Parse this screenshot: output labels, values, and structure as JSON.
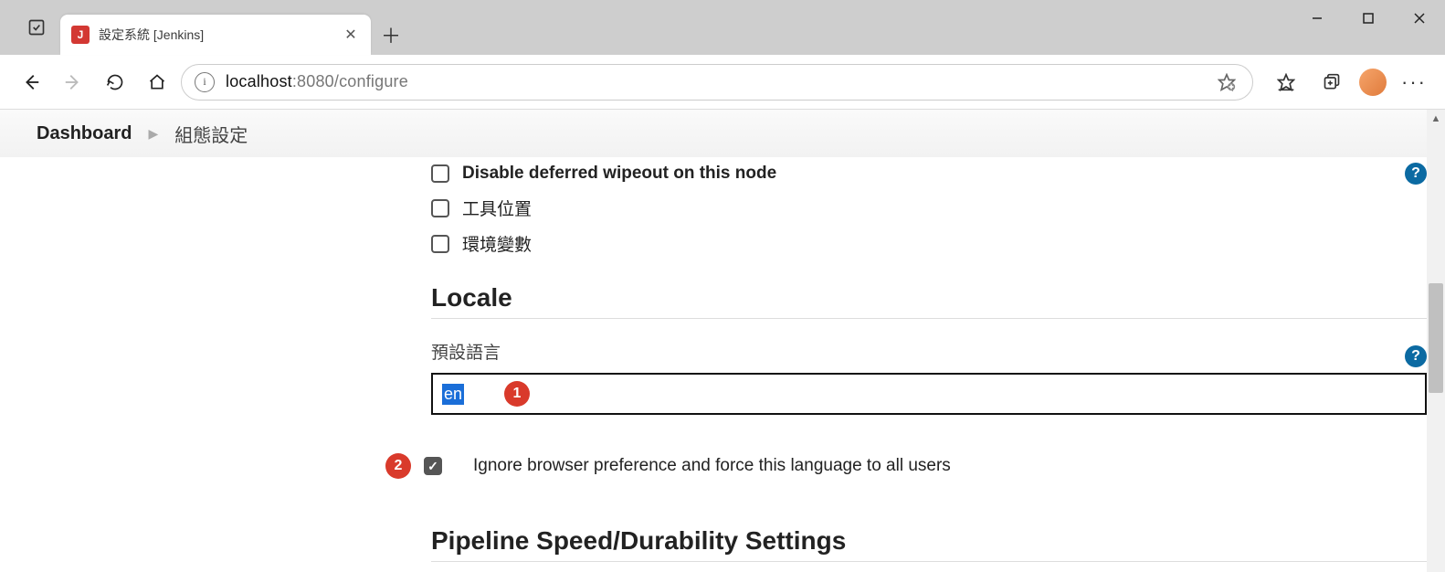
{
  "browser": {
    "tab_title": "設定系統 [Jenkins]",
    "url_host": "localhost",
    "url_port_path": ":8080/configure"
  },
  "breadcrumb": {
    "dashboard": "Dashboard",
    "config": "組態設定"
  },
  "checkboxes": {
    "disable_wipeout": "Disable deferred wipeout on this node",
    "tool_locations": "工具位置",
    "env_vars": "環境變數"
  },
  "locale": {
    "section_title": "Locale",
    "default_language_label": "預設語言",
    "value": "en",
    "ignore_label": "Ignore browser preference and force this language to all users",
    "ignore_checked": true
  },
  "pipeline": {
    "section_title": "Pipeline Speed/Durability Settings"
  },
  "annotations": {
    "badge1": "1",
    "badge2": "2"
  }
}
